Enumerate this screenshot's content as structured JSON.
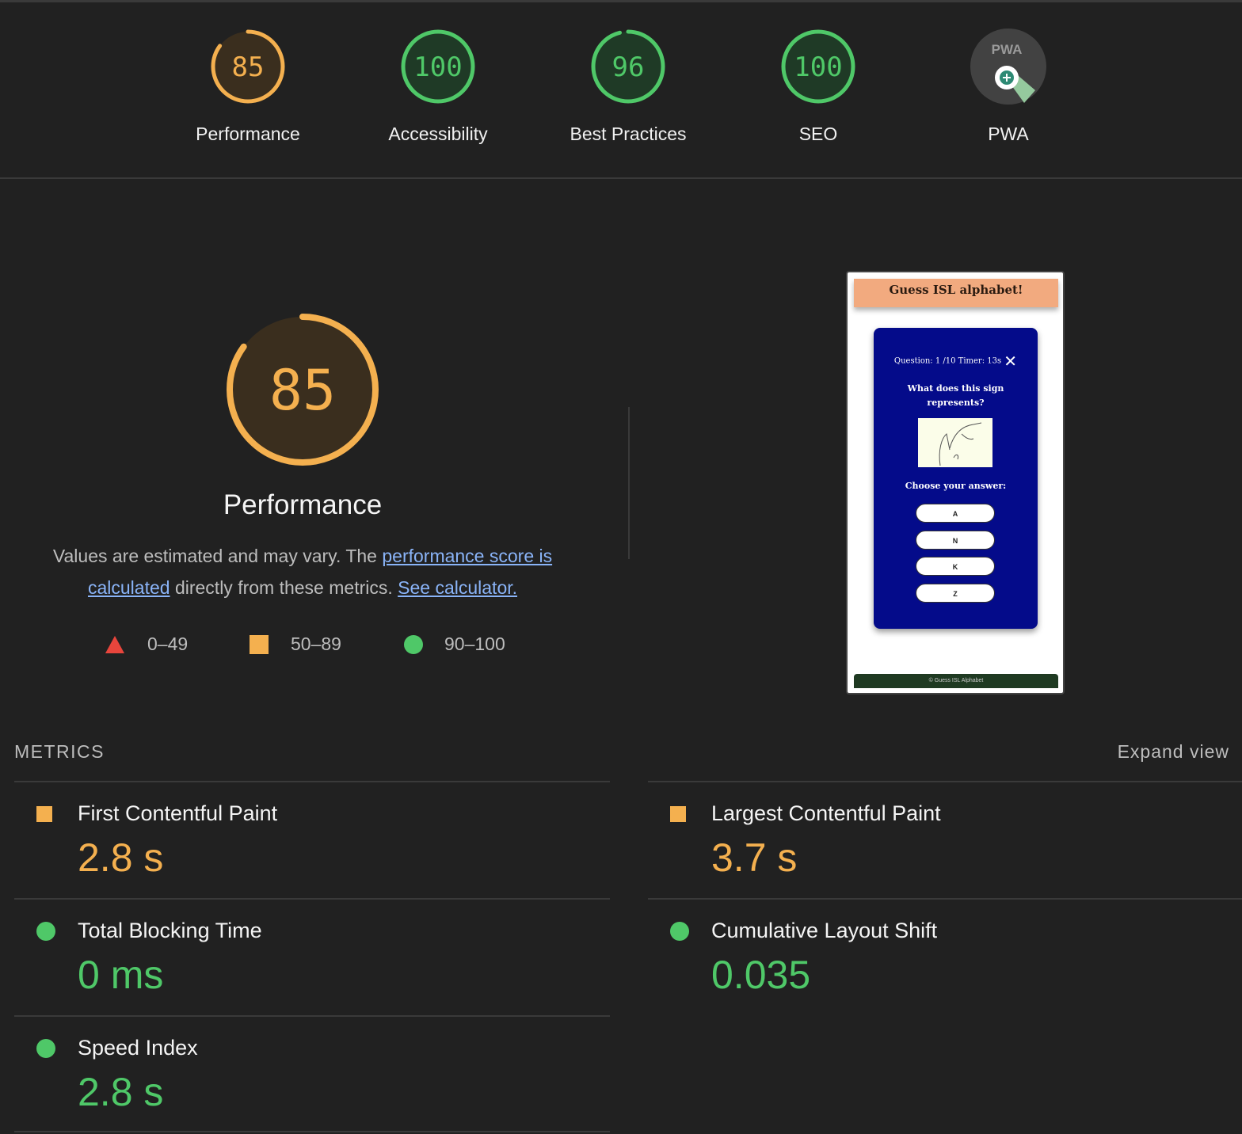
{
  "colors": {
    "pass": "#4fc868",
    "average": "#f4b04f",
    "fail": "#e8453c",
    "pass_bg": "#1f3a26",
    "average_bg": "#3a2e1e",
    "pwa_bg": "#424242"
  },
  "categories": [
    {
      "label": "Performance",
      "score": 85,
      "rating": "average"
    },
    {
      "label": "Accessibility",
      "score": 100,
      "rating": "pass"
    },
    {
      "label": "Best Practices",
      "score": 96,
      "rating": "pass"
    },
    {
      "label": "SEO",
      "score": 100,
      "rating": "pass"
    },
    {
      "label": "PWA",
      "badge_text": "PWA",
      "icon": "pwa-badge-icon"
    }
  ],
  "main": {
    "score": 85,
    "title": "Performance",
    "desc_prefix": "Values are estimated and may vary. The ",
    "link1": "performance score is calculated",
    "desc_mid": " directly from these metrics. ",
    "link2": "See calculator.",
    "legend": [
      {
        "shape": "triangle",
        "range": "0–49"
      },
      {
        "shape": "square",
        "range": "50–89"
      },
      {
        "shape": "circle",
        "range": "90–100"
      }
    ]
  },
  "screenshot": {
    "header": "Guess ISL alphabet!",
    "question": "Question: 1 /10 Timer: 13s",
    "ask": "What does this sign represents?",
    "choose": "Choose your answer:",
    "options": [
      "A",
      "N",
      "K",
      "Z"
    ],
    "footer": "© Guess ISL Alphabet"
  },
  "metrics": {
    "title": "METRICS",
    "expand": "Expand view",
    "items": [
      {
        "name": "First Contentful Paint",
        "value": "2.8 s",
        "rating": "average"
      },
      {
        "name": "Largest Contentful Paint",
        "value": "3.7 s",
        "rating": "average"
      },
      {
        "name": "Total Blocking Time",
        "value": "0 ms",
        "rating": "pass"
      },
      {
        "name": "Cumulative Layout Shift",
        "value": "0.035",
        "rating": "pass"
      },
      {
        "name": "Speed Index",
        "value": "2.8 s",
        "rating": "pass"
      }
    ]
  }
}
